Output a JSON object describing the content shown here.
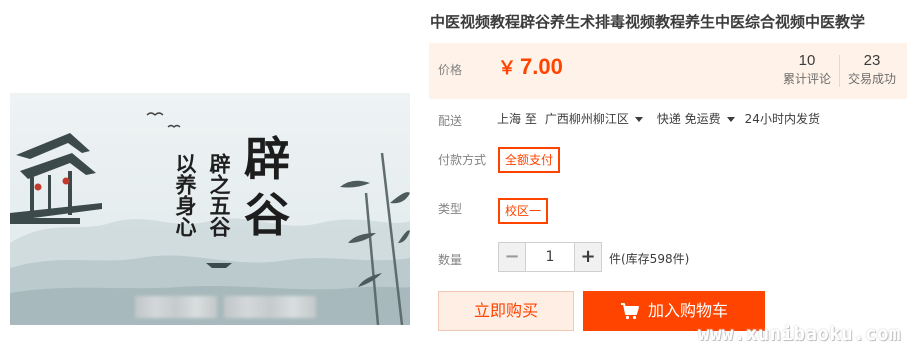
{
  "product": {
    "title": "中医视频教程辟谷养生术排毒视频教程养生中医综合视频中医教学",
    "image": {
      "big_text_1": "辟",
      "big_text_2": "谷",
      "vertical_right": "辟之五谷",
      "vertical_left": "以养身心"
    }
  },
  "price": {
    "label": "价格",
    "currency": "￥",
    "amount": "7.00",
    "reviews_count": "10",
    "reviews_label": "累计评论",
    "sales_count": "23",
    "sales_label": "交易成功"
  },
  "shipping": {
    "label": "配送",
    "from": "上海 至",
    "to": "广西柳州柳江区",
    "method": "快递 免运费",
    "dispatch": "24小时内发货"
  },
  "payment": {
    "label": "付款方式",
    "option": "全额支付"
  },
  "type": {
    "label": "类型",
    "option": "校区一"
  },
  "quantity": {
    "label": "数量",
    "minus": "−",
    "value": "1",
    "plus": "+",
    "stock": "件(库存598件)"
  },
  "actions": {
    "buy_now": "立即购买",
    "add_to_cart": "加入购物车"
  },
  "watermark": "www.xunibaoku.com",
  "colors": {
    "accent": "#ff4400",
    "price_bg": "#fff2e8",
    "buy_now_bg": "#ffeee4"
  }
}
